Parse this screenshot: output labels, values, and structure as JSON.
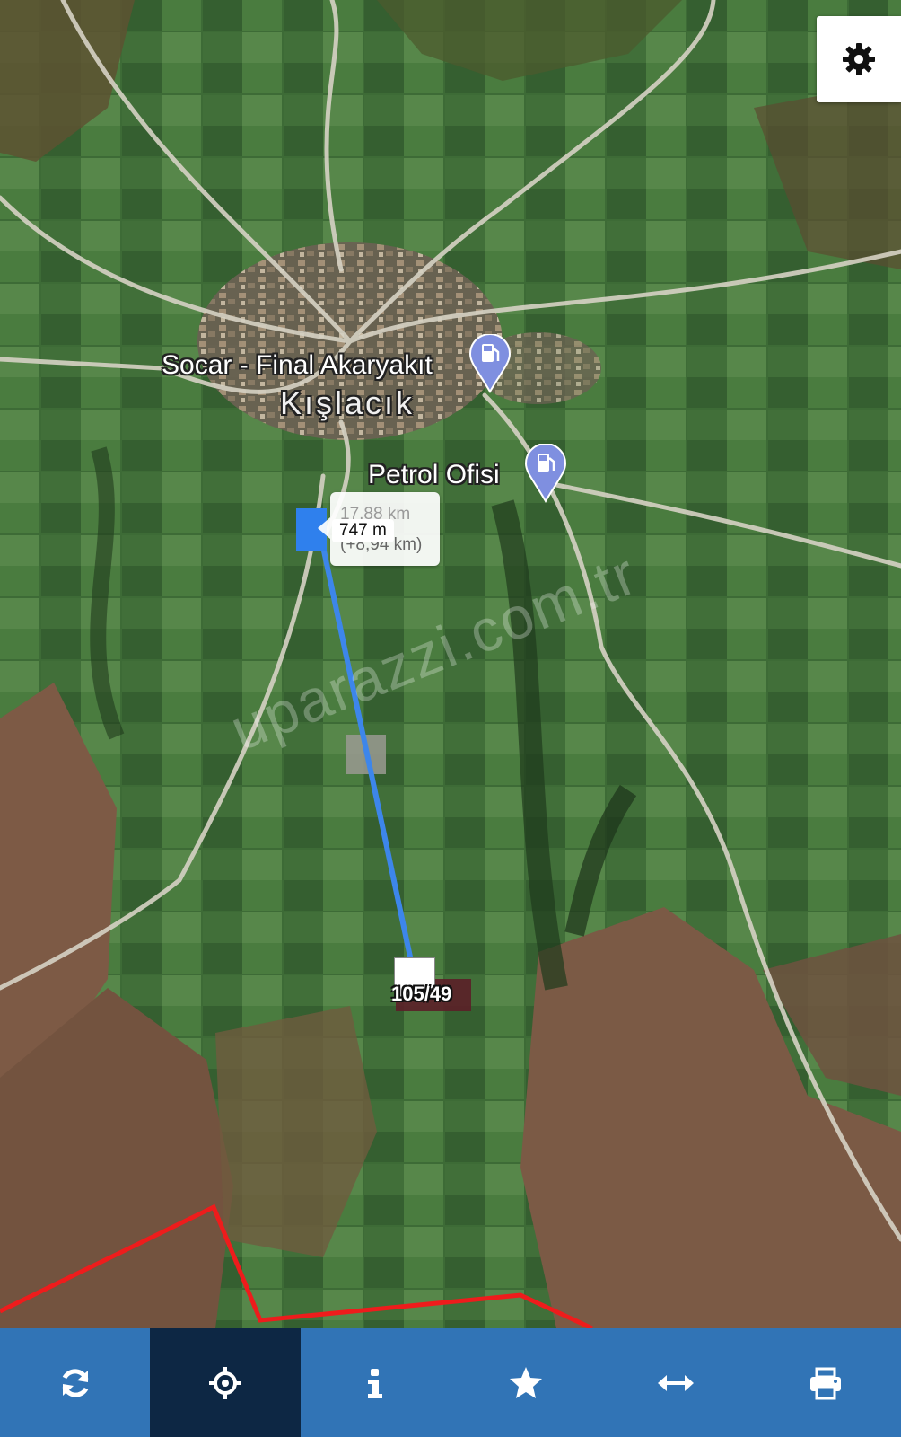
{
  "map": {
    "pois": [
      {
        "name": "Socar - Final Akaryakıt",
        "icon": "fuel-pump-pin-icon"
      },
      {
        "name": "Petrol Ofisi",
        "icon": "fuel-pump-pin-icon"
      }
    ],
    "village": "Kışlacık",
    "watermark": "uparazzi.com.tr",
    "parcel_label": "105/49",
    "boundary_color": "#ee1c1c",
    "measure_line_color": "#3d86ea"
  },
  "measurement": {
    "total": "17,88 km",
    "segment": "747 m",
    "delta": "(+8,94 km)"
  },
  "controls": {
    "settings_icon": "gear-icon"
  },
  "toolbar": {
    "active_index": 1,
    "items": [
      {
        "icon": "refresh-icon"
      },
      {
        "icon": "locate-crosshair-icon"
      },
      {
        "icon": "info-icon"
      },
      {
        "icon": "star-icon"
      },
      {
        "icon": "measure-arrows-icon"
      },
      {
        "icon": "print-icon"
      }
    ]
  }
}
